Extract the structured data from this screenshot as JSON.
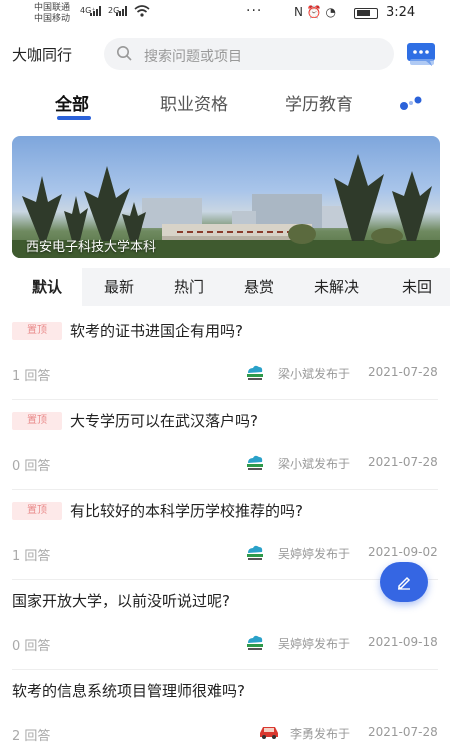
{
  "status_bar": {
    "carrier1": "中国联通",
    "carrier2": "中国移动",
    "signal1": "4G⁺",
    "signal2": "2G",
    "dots": "···",
    "icons": "N ⏰ ◔",
    "time": "3:24"
  },
  "header": {
    "brand": "大咖同行",
    "search_placeholder": "搜索问题或项目"
  },
  "categories": [
    "全部",
    "职业资格",
    "学历教育"
  ],
  "banner": {
    "caption": "西安电子科技大学本科"
  },
  "filters": [
    "默认",
    "最新",
    "热门",
    "悬赏",
    "未解决",
    "未回"
  ],
  "questions": [
    {
      "pinned": "置顶",
      "title": "软考的证书进国企有用吗?",
      "answers": "1 回答",
      "author": "梁小斌发布于",
      "date": "2021-07-28"
    },
    {
      "pinned": "置顶",
      "title": "大专学历可以在武汉落户吗?",
      "answers": "0 回答",
      "author": "梁小斌发布于",
      "date": "2021-07-28"
    },
    {
      "pinned": "置顶",
      "title": "有比较好的本科学历学校推荐的吗?",
      "answers": "1 回答",
      "author": "吴婷婷发布于",
      "date": "2021-09-02"
    },
    {
      "pinned": "",
      "title": "国家开放大学，以前没听说过呢?",
      "answers": "0 回答",
      "author": "吴婷婷发布于",
      "date": "2021-09-18"
    },
    {
      "pinned": "",
      "title": "软考的信息系统项目管理师很难吗?",
      "answers": "2 回答",
      "author": "李勇发布于",
      "date": "2021-07-28"
    }
  ],
  "colors": {
    "accent": "#2b62d9",
    "fab": "#3566e3",
    "pinned_bg": "#fde9e9",
    "pinned_text": "#e98a8a"
  }
}
